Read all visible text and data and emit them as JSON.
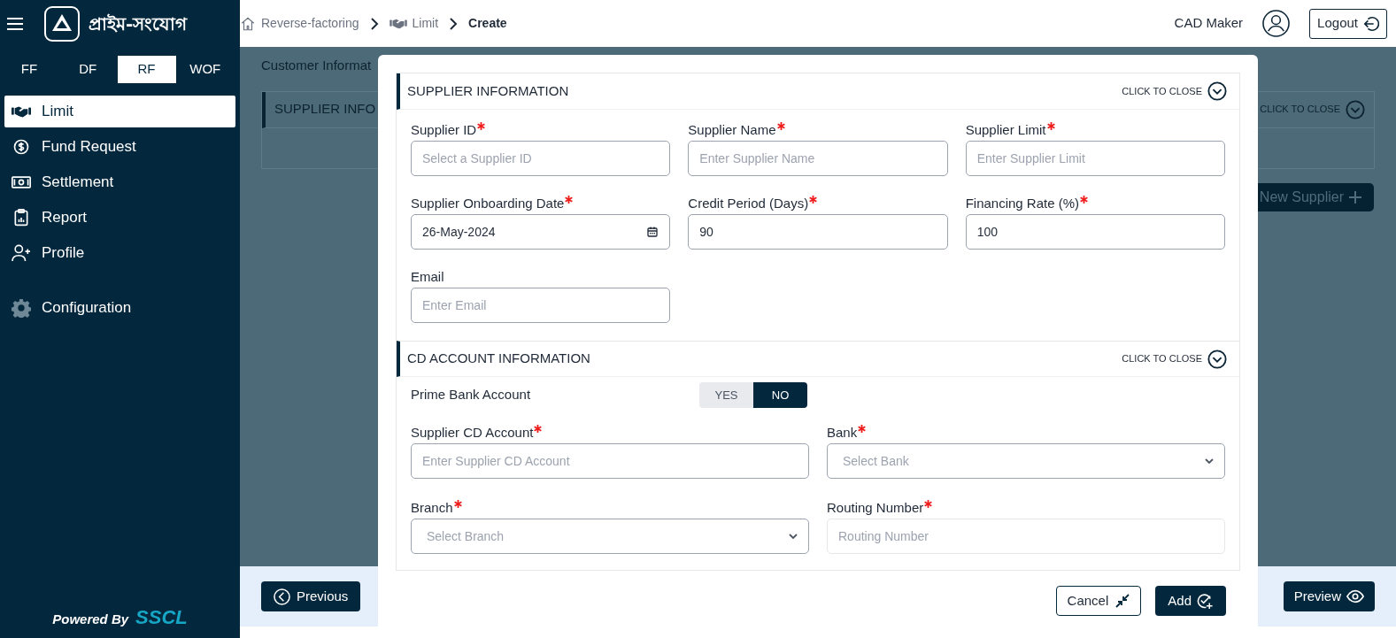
{
  "brand": {
    "title": "প্রাইম-সংযোগ"
  },
  "product_tabs": [
    {
      "label": "FF",
      "selected": false
    },
    {
      "label": "DF",
      "selected": false
    },
    {
      "label": "RF",
      "selected": true
    },
    {
      "label": "WOF",
      "selected": false
    }
  ],
  "sidebar": {
    "items": [
      {
        "label": "Limit",
        "selected": true
      },
      {
        "label": "Fund Request",
        "selected": false
      },
      {
        "label": "Settlement",
        "selected": false
      },
      {
        "label": "Report",
        "selected": false
      },
      {
        "label": "Profile",
        "selected": false
      }
    ],
    "config_item": {
      "label": "Configuration",
      "selected": false
    },
    "footer": {
      "powered_by": "Powered By",
      "company": "SSCL"
    }
  },
  "breadcrumb": [
    "Reverse-factoring",
    "Limit",
    "Create"
  ],
  "user": {
    "role": "CAD Maker",
    "logout": "Logout"
  },
  "background": {
    "heading": "Customer Informat",
    "section_title": "SUPPLIER INFO",
    "section_action": "CLICK TO CLOSE",
    "new_button": "New Supplier",
    "previous_button": "Previous",
    "preview_button": "Preview"
  },
  "modal": {
    "sections": [
      {
        "title": "SUPPLIER INFORMATION",
        "action": "CLICK TO CLOSE",
        "rows": [
          [
            {
              "label": "Supplier ID",
              "required": true,
              "kind": "text",
              "placeholder": "Select a Supplier ID",
              "disabled": false
            },
            {
              "label": "Supplier Name",
              "required": true,
              "kind": "text",
              "placeholder": "Enter Supplier Name",
              "disabled": false
            },
            {
              "label": "Supplier Limit",
              "required": true,
              "kind": "text",
              "placeholder": "Enter Supplier Limit",
              "disabled": false
            }
          ],
          [
            {
              "label": "Supplier Onboarding Date",
              "required": true,
              "kind": "date",
              "value": "26-May-2024",
              "disabled": false
            },
            {
              "label": "Credit Period (Days)",
              "required": true,
              "kind": "text",
              "value": "90",
              "disabled": false
            },
            {
              "label": "Financing Rate (%)",
              "required": true,
              "kind": "text",
              "value": "100",
              "disabled": false
            }
          ],
          [
            {
              "label": "Email",
              "required": false,
              "kind": "text",
              "placeholder": "Enter Email",
              "disabled": false
            }
          ]
        ]
      },
      {
        "title": "CD ACCOUNT INFORMATION",
        "action": "CLICK TO CLOSE",
        "toggle": {
          "label": "Prime Bank Account",
          "options": [
            {
              "label": "YES",
              "selected": false
            },
            {
              "label": "NO",
              "selected": true
            }
          ]
        },
        "rows": [
          [
            {
              "label": "Supplier CD Account",
              "required": true,
              "kind": "text",
              "placeholder": "Enter Supplier CD Account",
              "disabled": false
            },
            {
              "label": "Bank",
              "required": true,
              "kind": "select",
              "placeholder": "Select Bank",
              "disabled": false
            }
          ],
          [
            {
              "label": "Branch",
              "required": true,
              "kind": "select",
              "placeholder": "Select Branch",
              "disabled": false
            },
            {
              "label": "Routing Number",
              "required": true,
              "kind": "text",
              "placeholder": "Routing Number",
              "disabled": true
            }
          ]
        ]
      }
    ],
    "buttons": {
      "cancel": "Cancel",
      "add": "Add"
    }
  }
}
